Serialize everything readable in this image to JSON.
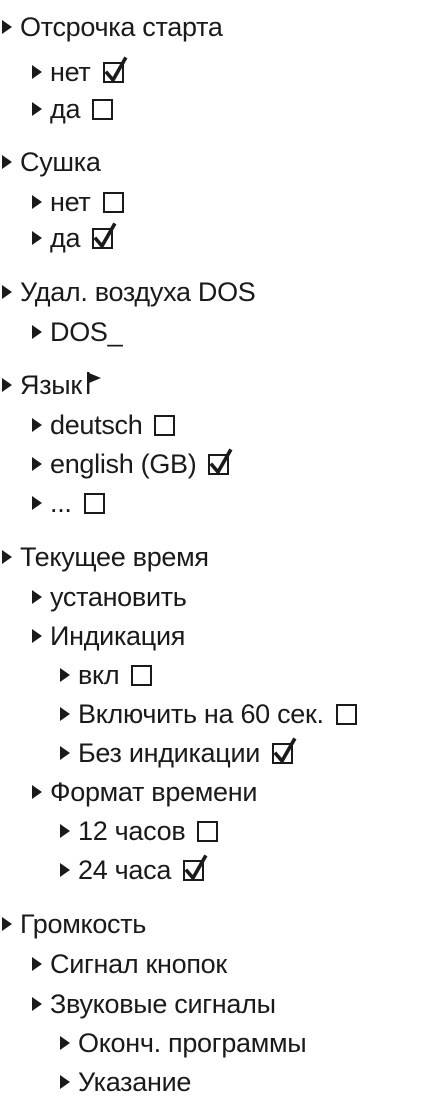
{
  "menu": {
    "items": [
      {
        "label": "Отсрочка старта",
        "level": 0,
        "control": null
      },
      {
        "label": "нет",
        "level": 1,
        "control": "checkbox",
        "checked": true
      },
      {
        "label": "да",
        "level": 1,
        "control": "checkbox",
        "checked": false
      },
      {
        "label": "Сушка",
        "level": 0,
        "control": null
      },
      {
        "label": "нет",
        "level": 1,
        "control": "checkbox",
        "checked": false
      },
      {
        "label": "да",
        "level": 1,
        "control": "checkbox",
        "checked": true
      },
      {
        "label": "Удал. воздуха DOS",
        "level": 0,
        "control": null
      },
      {
        "label": "DOS_",
        "level": 1,
        "control": null
      },
      {
        "label": "Язык",
        "level": 0,
        "control": "flag",
        "icon": "flag-icon"
      },
      {
        "label": "deutsch",
        "level": 1,
        "control": "checkbox",
        "checked": false
      },
      {
        "label": "english (GB)",
        "level": 1,
        "control": "checkbox",
        "checked": true
      },
      {
        "label": "...",
        "level": 1,
        "control": "checkbox",
        "checked": false
      },
      {
        "label": "Текущее время",
        "level": 0,
        "control": null
      },
      {
        "label": "установить",
        "level": 1,
        "control": null
      },
      {
        "label": "Индикация",
        "level": 1,
        "control": null
      },
      {
        "label": "вкл",
        "level": 2,
        "control": "checkbox",
        "checked": false
      },
      {
        "label": "Включить на 60 сек.",
        "level": 2,
        "control": "checkbox",
        "checked": false
      },
      {
        "label": "Без индикации",
        "level": 2,
        "control": "checkbox",
        "checked": true
      },
      {
        "label": "Формат времени",
        "level": 1,
        "control": null
      },
      {
        "label": "12 часов",
        "level": 2,
        "control": "checkbox",
        "checked": false
      },
      {
        "label": "24 часа",
        "level": 2,
        "control": "checkbox",
        "checked": true
      },
      {
        "label": "Громкость",
        "level": 0,
        "control": null
      },
      {
        "label": "Сигнал кнопок",
        "level": 1,
        "control": null
      },
      {
        "label": "Звуковые сигналы",
        "level": 1,
        "control": null
      },
      {
        "label": "Оконч. программы",
        "level": 2,
        "control": null
      },
      {
        "label": "Указание",
        "level": 2,
        "control": null
      }
    ]
  }
}
